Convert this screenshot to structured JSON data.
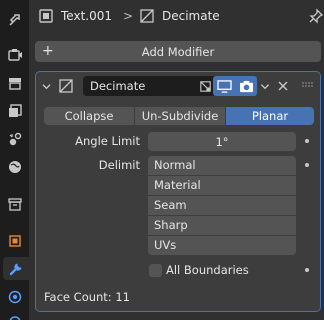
{
  "tabs": [
    {
      "icon": "tool-icon"
    },
    {
      "icon": "render-icon"
    },
    {
      "icon": "output-icon"
    },
    {
      "icon": "view-layer-icon"
    },
    {
      "icon": "scene-icon"
    },
    {
      "icon": "world-icon"
    },
    {
      "icon": "collection-icon"
    },
    {
      "icon": "object-icon"
    },
    {
      "icon": "modifier-icon",
      "active": true
    },
    {
      "icon": "particles-icon"
    },
    {
      "icon": "physics-icon"
    }
  ],
  "header": {
    "object_name": "Text.001",
    "separator": ">",
    "modifier_name": "Decimate"
  },
  "add_modifier": {
    "label": "Add Modifier"
  },
  "modifier": {
    "name": "Decimate",
    "modes": [
      "Collapse",
      "Un-Subdivide",
      "Planar"
    ],
    "active_mode": "Planar",
    "angle_limit_label": "Angle Limit",
    "angle_limit_value": "1°",
    "delimit_label": "Delimit",
    "delimit_options": [
      "Normal",
      "Material",
      "Seam",
      "Sharp",
      "UVs"
    ],
    "all_boundaries_label": "All Boundaries",
    "all_boundaries_checked": false,
    "face_count": "Face Count: 11"
  },
  "colors": {
    "accent": "#4772b3",
    "panel_bg": "#3d3d3d",
    "field_bg": "#545454",
    "tabstrip_bg": "#1d1d1d"
  }
}
